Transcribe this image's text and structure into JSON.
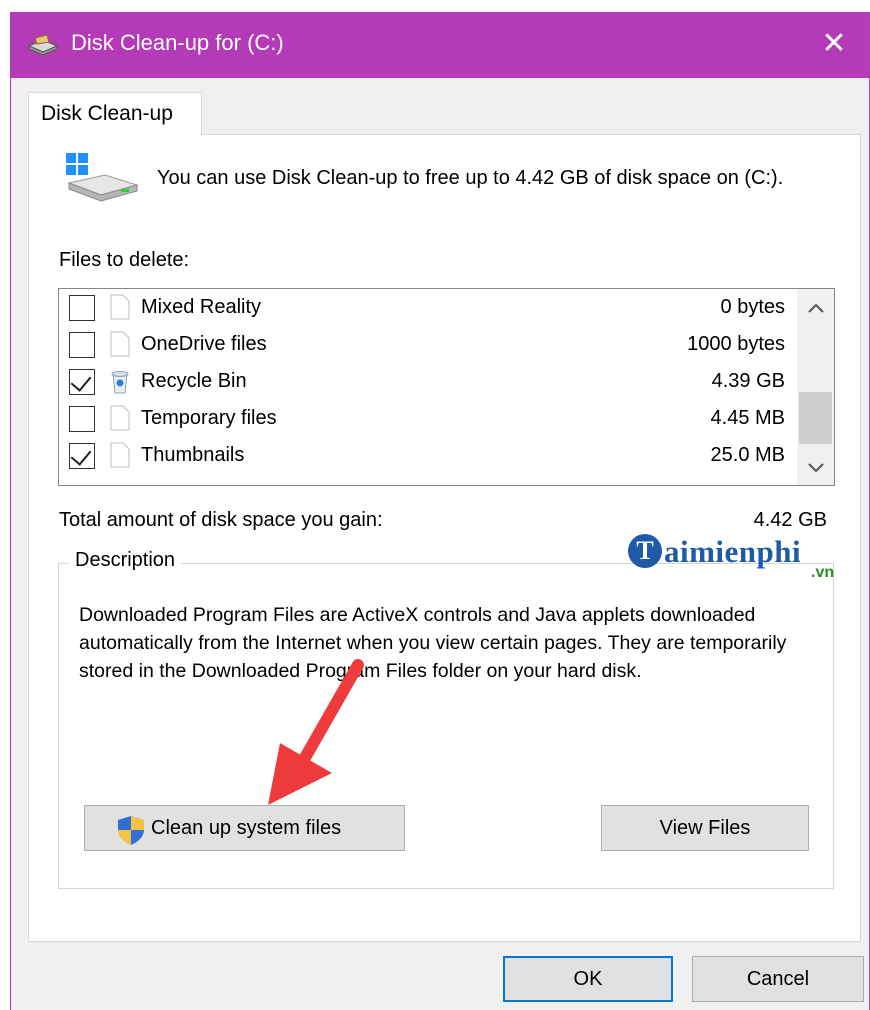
{
  "window": {
    "title": "Disk Clean-up for  (C:)",
    "close_symbol": "✕",
    "accent_color": "#b53ab8"
  },
  "tab": {
    "label": "Disk Clean-up"
  },
  "intro_text": "You can use Disk Clean-up to free up to 4.42 GB of disk space on (C:).",
  "files_label": "Files to delete:",
  "files": [
    {
      "name": "Mixed Reality",
      "size": "0 bytes",
      "checked": false,
      "icon": "blank-file-icon"
    },
    {
      "name": "OneDrive files",
      "size": "1000 bytes",
      "checked": false,
      "icon": "blank-file-icon"
    },
    {
      "name": "Recycle Bin",
      "size": "4.39 GB",
      "checked": true,
      "icon": "recycle-bin-icon"
    },
    {
      "name": "Temporary files",
      "size": "4.45 MB",
      "checked": false,
      "icon": "blank-file-icon"
    },
    {
      "name": "Thumbnails",
      "size": "25.0 MB",
      "checked": true,
      "icon": "blank-file-icon"
    }
  ],
  "total": {
    "label": "Total amount of disk space you gain:",
    "value": "4.42 GB"
  },
  "description": {
    "legend": "Description",
    "text": "Downloaded Program Files are ActiveX controls and Java applets downloaded automatically from the Internet when you view certain pages. They are temporarily stored in the Downloaded Program Files folder on your hard disk."
  },
  "buttons": {
    "cleanup_system": "Clean up system files",
    "view_files": "View Files",
    "ok": "OK",
    "cancel": "Cancel"
  },
  "watermark": {
    "badge": "T",
    "name": "aimienphi",
    "suffix": ".vn"
  }
}
